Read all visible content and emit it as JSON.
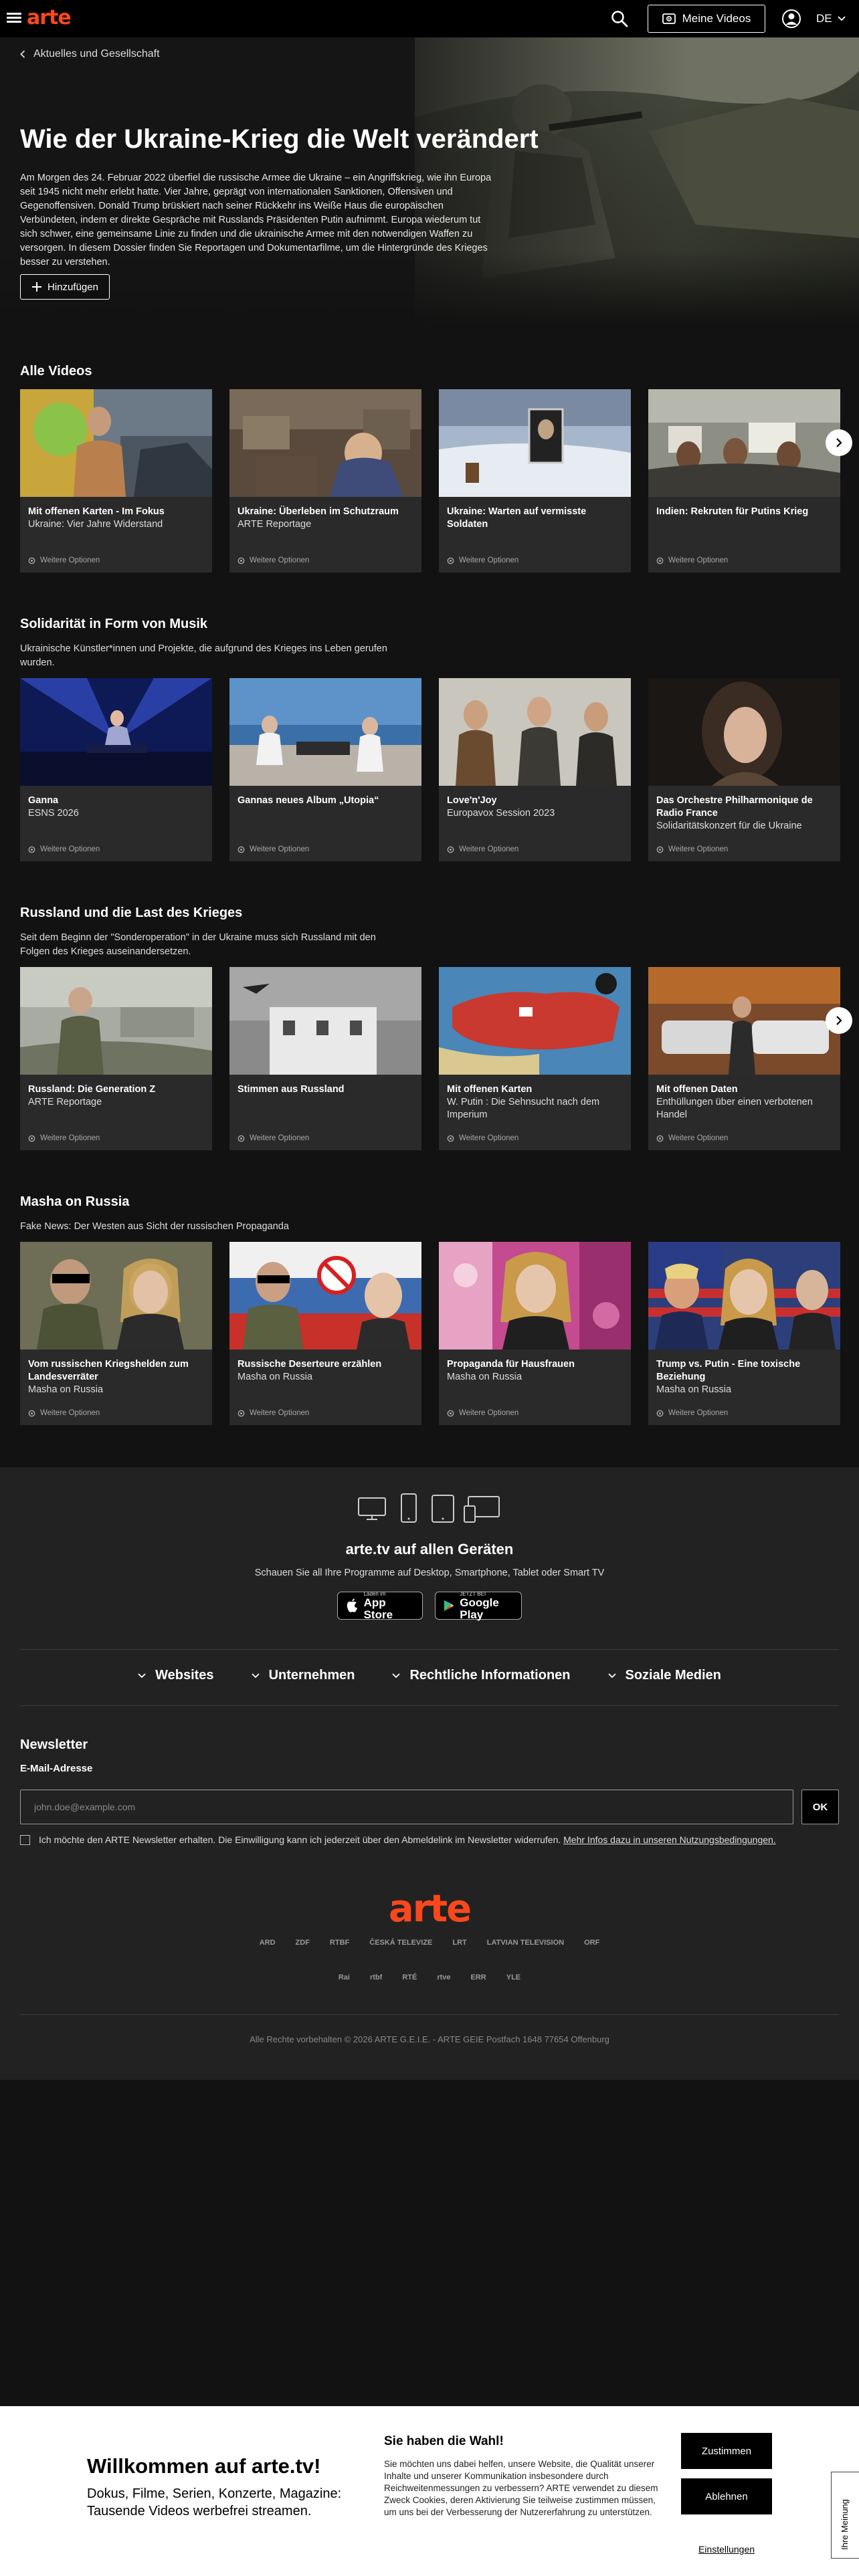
{
  "header": {
    "logo": "arte",
    "my_videos": "Meine Videos",
    "language": "DE"
  },
  "hero": {
    "breadcrumb": "Aktuelles und Gesellschaft",
    "title": "Wie der Ukraine-Krieg die Welt verändert",
    "description": "Am Morgen des 24. Februar 2022 überfiel die russische Armee die Ukraine – ein Angriffskrieg, wie ihn Europa seit 1945 nicht mehr erlebt hatte. Vier Jahre, geprägt von internationalen Sanktionen, Offensiven und Gegenoffensiven. Donald Trump brüskiert nach seiner Rückkehr ins Weiße Haus die europäischen Verbündeten, indem er direkte Gespräche mit Russlands Präsidenten Putin aufnimmt. Europa wiederum tut sich schwer, eine gemeinsame Linie zu finden und die ukrainische Armee mit den notwendigen Waffen zu versorgen. In diesem Dossier finden Sie Reportagen und Dokumentarfilme, um die Hintergründe des Krieges besser zu verstehen.",
    "add_button": "Hinzufügen"
  },
  "options_label": "Weitere Optionen",
  "sections": [
    {
      "title": "Alle Videos",
      "subtitle": "",
      "cards": [
        {
          "title": "Mit offenen Karten - Im Fokus",
          "subtitle": "Ukraine: Vier Jahre Widerstand"
        },
        {
          "title": "Ukraine: Überleben im Schutzraum",
          "subtitle": "ARTE Reportage"
        },
        {
          "title": "Ukraine: Warten auf vermisste Soldaten",
          "subtitle": ""
        },
        {
          "title": "Indien: Rekruten für Putins Krieg",
          "subtitle": ""
        }
      ]
    },
    {
      "title": "Solidarität in Form von Musik",
      "subtitle": "Ukrainische Künstler*innen und Projekte, die aufgrund des Krieges ins Leben gerufen wurden.",
      "cards": [
        {
          "title": "Ganna",
          "subtitle": "ESNS 2026"
        },
        {
          "title": "Gannas neues Album „Utopia“",
          "subtitle": ""
        },
        {
          "title": "Love'n'Joy",
          "subtitle": "Europavox Session 2023"
        },
        {
          "title": "Das Orchestre Philharmonique de Radio France",
          "subtitle": "Solidaritätskonzert für die Ukraine"
        }
      ]
    },
    {
      "title": "Russland und die Last des Krieges",
      "subtitle": "Seit dem Beginn der \"Sonderoperation\" in der Ukraine muss sich Russland mit den Folgen des Krieges auseinandersetzen.",
      "cards": [
        {
          "title": "Russland: Die Generation Z",
          "subtitle": "ARTE Reportage"
        },
        {
          "title": "Stimmen aus Russland",
          "subtitle": ""
        },
        {
          "title": "Mit offenen Karten",
          "subtitle": "W. Putin : Die Sehnsucht nach dem Imperium"
        },
        {
          "title": "Mit offenen Daten",
          "subtitle": "Enthüllungen über einen verbotenen Handel"
        }
      ]
    },
    {
      "title": "Masha on Russia",
      "subtitle": "Fake News: Der Westen aus Sicht der russischen Propaganda",
      "cards": [
        {
          "title": "Vom russischen Kriegshelden zum Landesverräter",
          "subtitle": "Masha on Russia"
        },
        {
          "title": "Russische Deserteure erzählen",
          "subtitle": "Masha on Russia"
        },
        {
          "title": "Propaganda für Hausfrauen",
          "subtitle": "Masha on Russia"
        },
        {
          "title": "Trump vs. Putin - Eine toxische Beziehung",
          "subtitle": "Masha on Russia"
        }
      ]
    }
  ],
  "footer": {
    "devices_title": "arte.tv auf allen Geräten",
    "devices_sub": "Schauen Sie all Ihre Programme auf Desktop, Smartphone, Tablet oder Smart TV",
    "appstore_small": "Laden im",
    "appstore_big": "App Store",
    "googleplay_small": "JETZT BEI",
    "googleplay_big": "Google Play",
    "links": [
      "Websites",
      "Unternehmen",
      "Rechtliche Informationen",
      "Soziale Medien"
    ],
    "newsletter_title": "Newsletter",
    "email_label": "E-Mail-Adresse",
    "email_placeholder": "john.doe@example.com",
    "ok": "OK",
    "consent": "Ich möchte den ARTE Newsletter erhalten. Die Einwilligung kann ich jederzeit über den Abmeldelink im Newsletter widerrufen. ",
    "consent_link": "Mehr Infos dazu in unseren Nutzungsbedingungen.",
    "logo": "arte",
    "partners_row1": [
      "ARD",
      "ZDF",
      "RTBF",
      "ČESKÁ TELEVIZE",
      "LRT",
      "LATVIAN TELEVISION",
      "ORF"
    ],
    "partners_row2": [
      "Rai",
      "rtbf",
      "RTÉ",
      "rtve",
      "ERR",
      "YLE"
    ],
    "copyright": "Alle Rechte vorbehalten © 2026 ARTE G.E.I.E. - ARTE GEIE Postfach 1648 77654 Offenburg"
  },
  "cookie": {
    "title": "Willkommen auf arte.tv!",
    "subtitle": "Dokus, Filme, Serien, Konzerte, Magazine: Tausende Videos werbefrei streamen.",
    "heading": "Sie haben die Wahl!",
    "text": "Sie möchten uns dabei helfen, unsere Website, die Qualität unserer Inhalte und unserer Kommunikation insbesondere durch Reichweitenmessungen zu verbessern? ARTE verwendet zu diesem Zweck Cookies, deren Aktivierung Sie teilweise zustimmen müssen, um uns bei der Verbesserung der Nutzererfahrung zu unterstützen.",
    "accept": "Zustimmen",
    "decline": "Ablehnen",
    "settings": "Einstellungen",
    "side_tab": "Ihre Meinung"
  },
  "colors": {
    "brand": "#fa481c",
    "background": "#121212",
    "card": "#2a2a2a",
    "footer": "#222222"
  }
}
